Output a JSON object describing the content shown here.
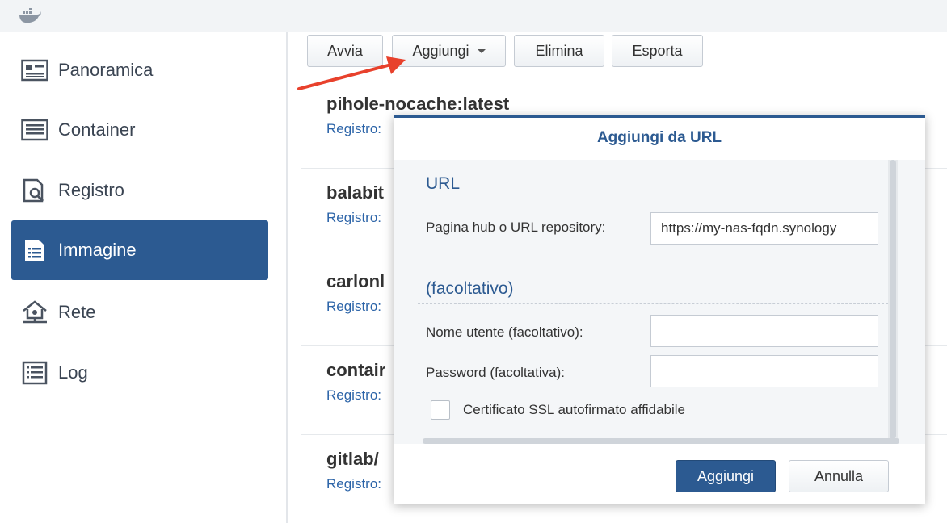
{
  "sidebar": {
    "items": [
      {
        "label": "Panoramica",
        "icon": "overview-icon"
      },
      {
        "label": "Container",
        "icon": "container-list-icon"
      },
      {
        "label": "Registro",
        "icon": "registry-search-icon"
      },
      {
        "label": "Immagine",
        "icon": "image-list-icon",
        "active": true
      },
      {
        "label": "Rete",
        "icon": "network-house-icon"
      },
      {
        "label": "Log",
        "icon": "log-list-icon"
      }
    ]
  },
  "toolbar": {
    "start_label": "Avvia",
    "add_label": "Aggiungi",
    "delete_label": "Elimina",
    "export_label": "Esporta"
  },
  "images": [
    {
      "name": "pihole-nocache:latest",
      "sub": "Registro:"
    },
    {
      "name": "balabit",
      "sub": "Registro:"
    },
    {
      "name": "carlonl",
      "sub": "Registro:"
    },
    {
      "name": "contair",
      "sub": "Registro:"
    },
    {
      "name": "gitlab/",
      "sub": "Registro:"
    }
  ],
  "dialog": {
    "title": "Aggiungi da URL",
    "section_url": "URL",
    "url_label": "Pagina hub o URL repository:",
    "url_value": "https://my-nas-fqdn.synology",
    "section_optional": "(facoltativo)",
    "username_label": "Nome utente (facoltativo):",
    "username_value": "",
    "password_label": "Password (facoltativa):",
    "password_value": "",
    "ssl_label": "Certificato SSL autofirmato affidabile",
    "ssl_checked": false,
    "ok_label": "Aggiungi",
    "cancel_label": "Annulla"
  },
  "colors": {
    "accent": "#2c5a91",
    "link": "#2c64a8",
    "annotation_arrow": "#e8412c"
  }
}
